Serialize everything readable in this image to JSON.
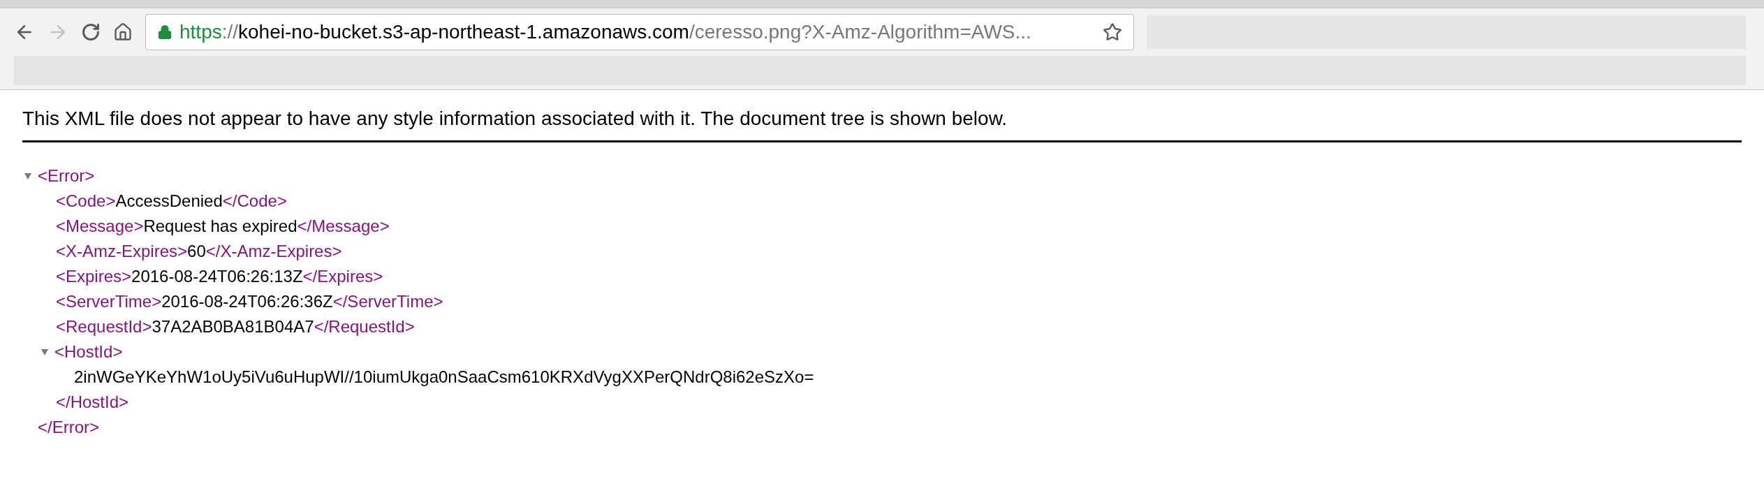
{
  "browser": {
    "url": {
      "secure": true,
      "scheme": "https",
      "separator": "://",
      "host": "kohei-no-bucket.s3-ap-northeast-1.amazonaws.com",
      "path": "/ceresso.png?X-Amz-Algorithm=AWS..."
    },
    "bookmarked": false,
    "back_enabled": true,
    "forward_enabled": false
  },
  "notice": "This XML file does not appear to have any style information associated with it. The document tree is shown below.",
  "tree": {
    "open": "<Error>",
    "close": "</Error>",
    "expanded": true,
    "children": [
      {
        "open": "<Code>",
        "text": "AccessDenied",
        "close": "</Code>"
      },
      {
        "open": "<Message>",
        "text": "Request has expired",
        "close": "</Message>"
      },
      {
        "open": "<X-Amz-Expires>",
        "text": "60",
        "close": "</X-Amz-Expires>"
      },
      {
        "open": "<Expires>",
        "text": "2016-08-24T06:26:13Z",
        "close": "</Expires>"
      },
      {
        "open": "<ServerTime>",
        "text": "2016-08-24T06:26:36Z",
        "close": "</ServerTime>"
      },
      {
        "open": "<RequestId>",
        "text": "37A2AB0BA81B04A7",
        "close": "</RequestId>"
      },
      {
        "open": "<HostId>",
        "text": "2inWGeYKeYhW1oUy5iVu6uHupWI//10iumUkga0nSaaCsm610KRXdVygXXPerQNdrQ8i62eSzXo=",
        "close": "</HostId>",
        "expanded": true
      }
    ]
  }
}
